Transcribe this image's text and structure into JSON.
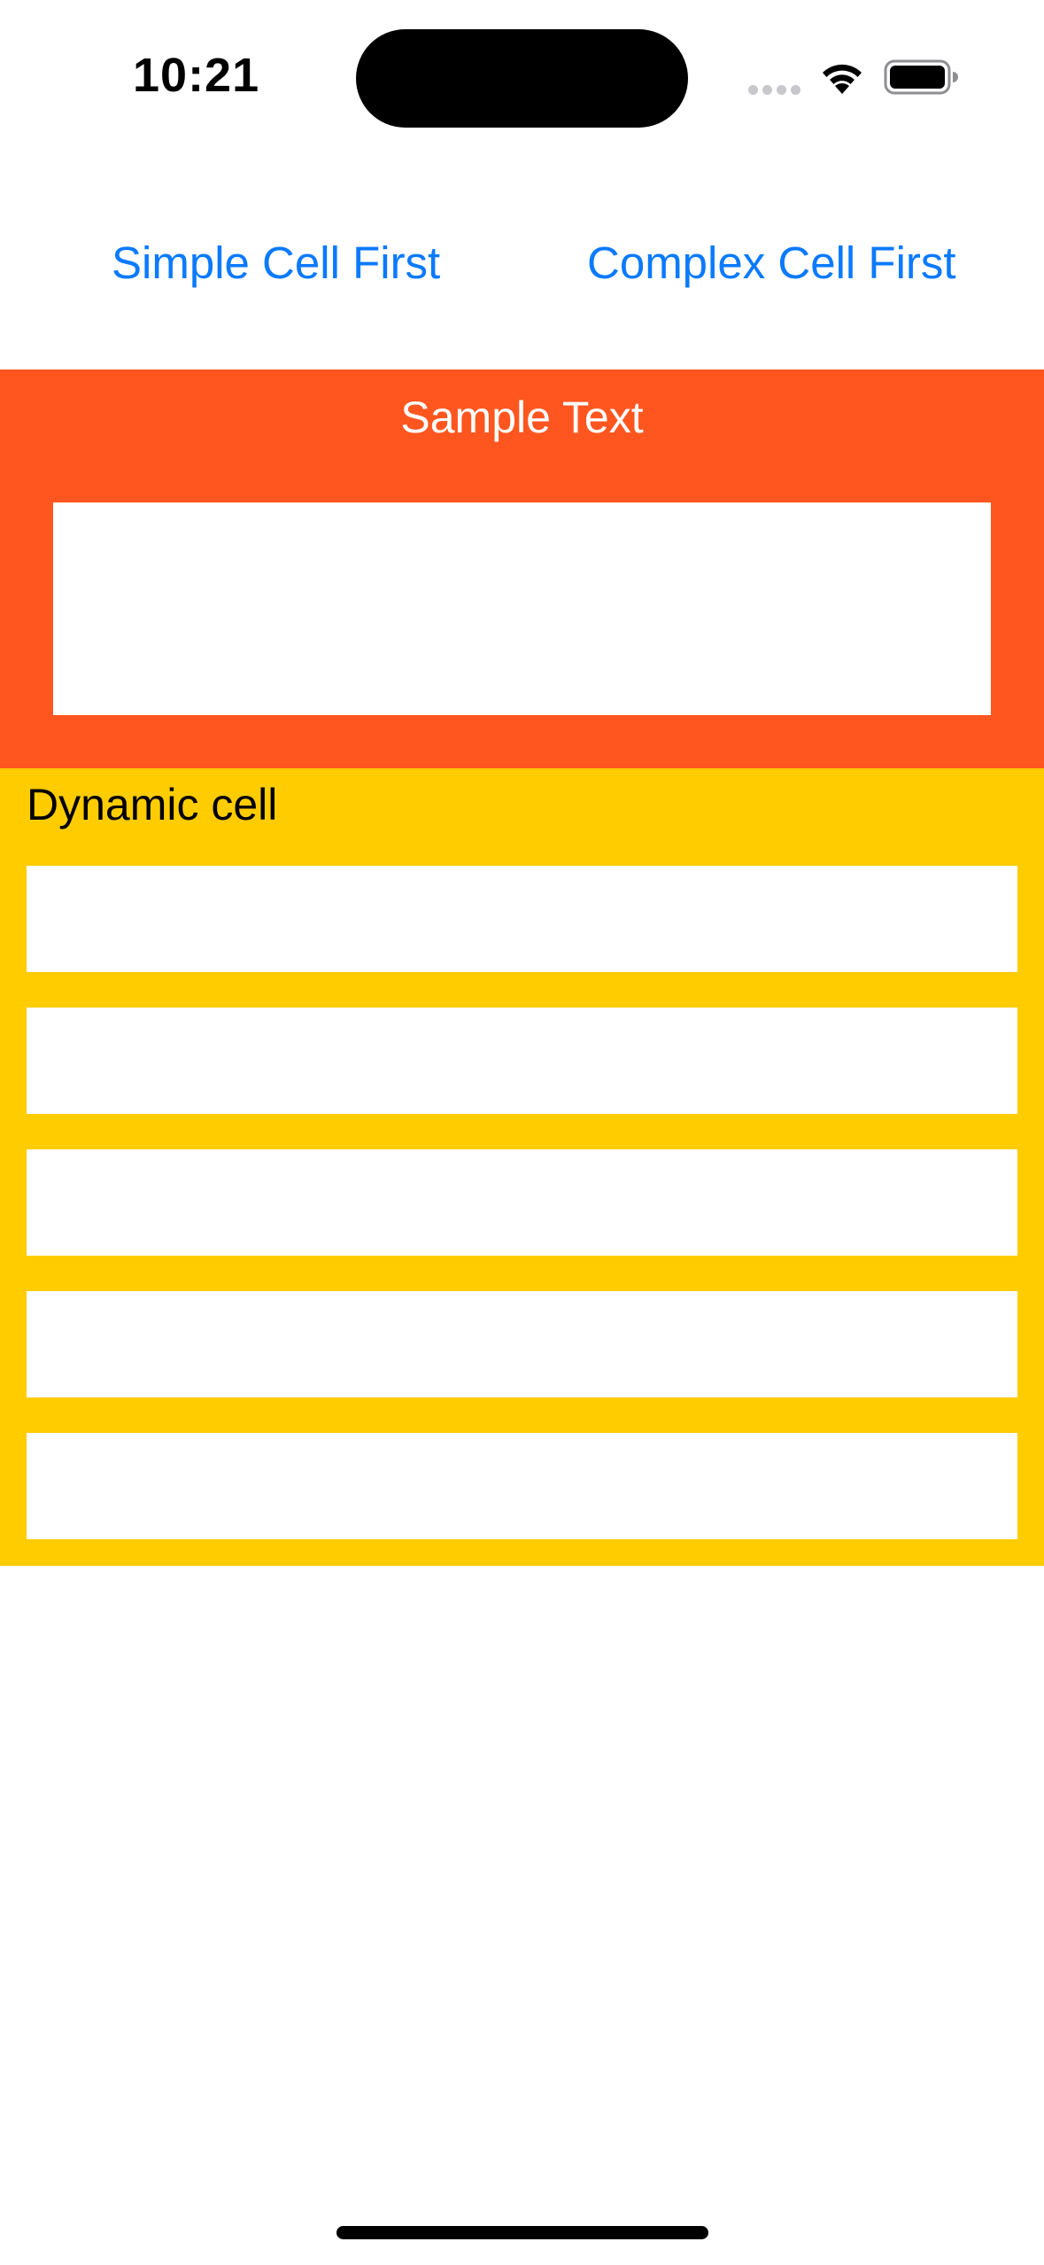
{
  "status_bar": {
    "time": "10:21",
    "icons": [
      "cellular-signal-icon",
      "wifi-icon",
      "battery-icon"
    ]
  },
  "buttons": {
    "simple_label": "Simple Cell First",
    "complex_label": "Complex Cell First"
  },
  "complex_cell": {
    "title": "Sample Text",
    "background": "#ff5620"
  },
  "dynamic_cell": {
    "title": "Dynamic cell",
    "background": "#ffcc00",
    "box_count": 5
  },
  "colors": {
    "accent": "#0a7aff"
  }
}
